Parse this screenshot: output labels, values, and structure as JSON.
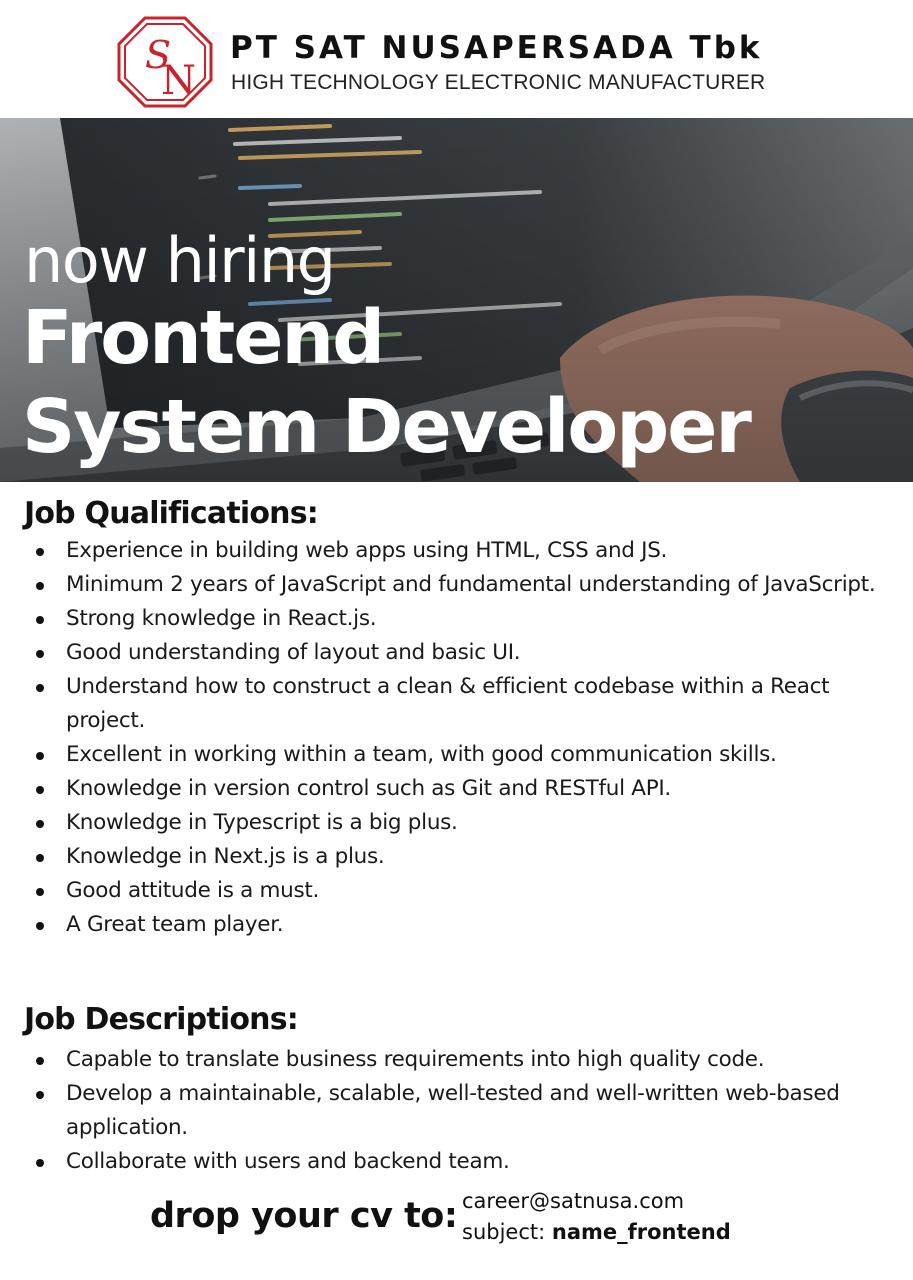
{
  "header": {
    "logo_letters": "SN",
    "company_name": "PT SAT NUSAPERSADA Tbk",
    "tagline": "HIGH TECHNOLOGY ELECTRONIC MANUFACTURER",
    "brand_color": "#c8242b"
  },
  "hero": {
    "line1": "now hiring",
    "line2": "Frontend",
    "line3": "System Developer"
  },
  "qualifications": {
    "title": "Job Qualifications:",
    "items": [
      "Experience in building web apps using HTML, CSS and JS.",
      "Minimum 2 years of JavaScript and fundamental understanding of JavaScript.",
      "Strong knowledge in React.js.",
      "Good understanding of layout and basic UI.",
      "Understand how to construct a clean & efficient codebase within a React project.",
      "Excellent in working within a team, with good communication skills.",
      "Knowledge in version control such as Git and RESTful API.",
      "Knowledge in Typescript is a big plus.",
      "Knowledge in Next.js is a plus.",
      "Good attitude is a must.",
      "A Great team player."
    ]
  },
  "descriptions": {
    "title": "Job Descriptions:",
    "items": [
      "Capable to translate business requirements into high quality code.",
      "Develop a maintainable, scalable, well-tested and well-written web-based application.",
      "Collaborate with users and backend team."
    ]
  },
  "footer": {
    "cta": "drop your cv to:",
    "email": "career@satnusa.com",
    "subject_label": "subject:",
    "subject_value": "name_frontend"
  }
}
